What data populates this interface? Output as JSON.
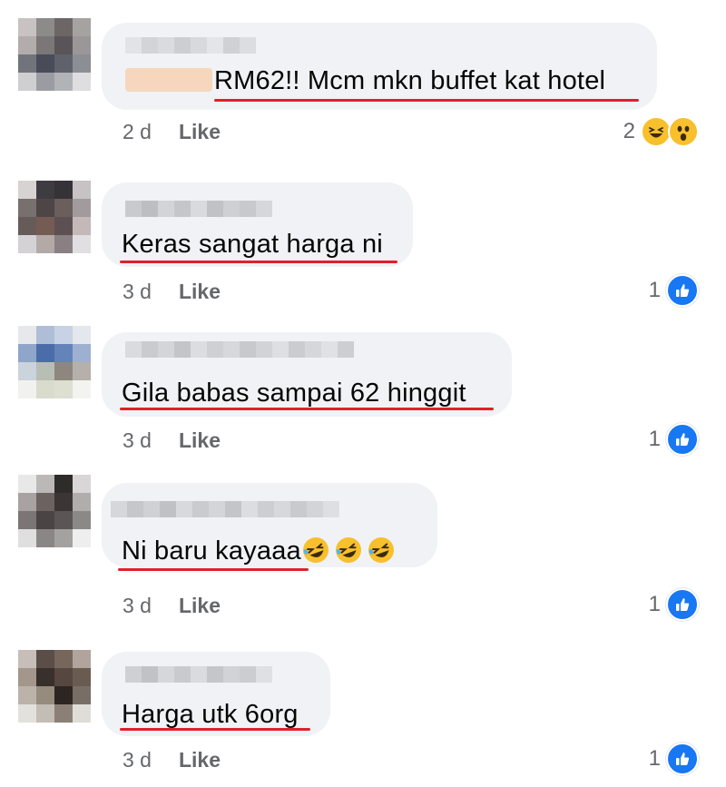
{
  "colors": {
    "bubble": "#f0f2f5",
    "underline": "#e0202a",
    "meta_text": "#65676b",
    "like_blue": "#1877f2",
    "emoji_yellow": "#f7c02c"
  },
  "comments": [
    {
      "text": "RM62!! Mcm mkn buffet kat hotel",
      "time": "2 d",
      "like_label": "Like",
      "reaction_count": "2",
      "reaction_icons": [
        "laughing-face-icon",
        "surprised-face-icon"
      ]
    },
    {
      "text": "Keras sangat harga ni",
      "time": "3 d",
      "like_label": "Like",
      "reaction_count": "1",
      "reaction_icons": [
        "thumbs-up-icon"
      ]
    },
    {
      "text": "Gila  babas sampai 62 hinggit",
      "time": "3 d",
      "like_label": "Like",
      "reaction_count": "1",
      "reaction_icons": [
        "thumbs-up-icon"
      ]
    },
    {
      "text": "Ni baru kayaaa",
      "text_emoji": [
        "rofl-emoji-icon",
        "rofl-emoji-icon",
        "rofl-emoji-icon"
      ],
      "time": "3 d",
      "like_label": "Like",
      "reaction_count": "1",
      "reaction_icons": [
        "thumbs-up-icon"
      ]
    },
    {
      "text": "Harga utk 6org",
      "time": "3 d",
      "like_label": "Like",
      "reaction_count": "1",
      "reaction_icons": [
        "thumbs-up-icon"
      ]
    }
  ]
}
